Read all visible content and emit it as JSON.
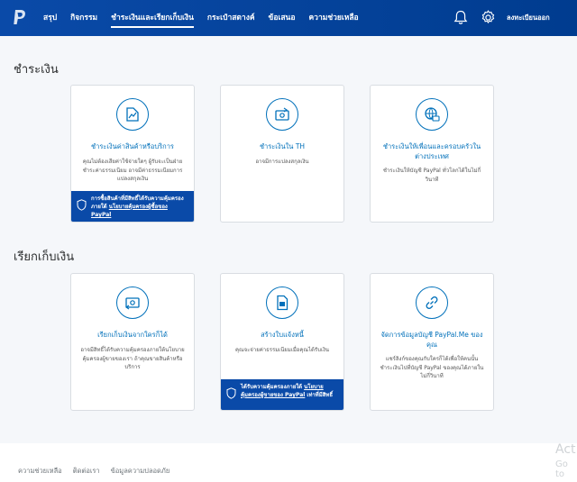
{
  "header": {
    "nav": [
      {
        "label": "สรุป"
      },
      {
        "label": "กิจกรรม"
      },
      {
        "label": "ชำระเงินและเรียกเก็บเงิน"
      },
      {
        "label": "กระเป๋าสตางค์"
      },
      {
        "label": "ข้อเสนอ"
      },
      {
        "label": "ความช่วยเหลือ"
      }
    ],
    "logout_label": "ลงทะเบียนออก",
    "brand_color": "#003c8f"
  },
  "pay": {
    "title": "ชำระเงิน",
    "cards": [
      {
        "title": "ชำระเงินค่าสินค้าหรือบริการ",
        "desc": "คุณไม่ต้องเสียค่าใช้จ่ายใดๆ ผู้รับจะเป็นฝ่ายชำระค่าธรรมเนียม อาจมีค่าธรรมเนียมการแปลงสกุลเงิน",
        "banner_text": "การซื้อสินค้าที่มีสิทธิ์ได้รับความคุ้มครองภายใต้",
        "banner_link": "นโยบายคุ้มครองผู้ซื้อของ PayPal",
        "icon": "receipt-icon"
      },
      {
        "title": "ชำระเงินใน TH",
        "desc": "อาจมีการแปลงสกุลเงิน",
        "icon": "send-money-icon"
      },
      {
        "title": "ชำระเงินให้เพื่อนและครอบครัวในต่างประเทศ",
        "desc": "ชำระเงินให้บัญชี PayPal ทั่วโลกได้ในไม่กี่วินาที",
        "icon": "globe-money-icon"
      }
    ]
  },
  "request": {
    "title": "เรียกเก็บเงิน",
    "cards": [
      {
        "title": "เรียกเก็บเงินจากใครก็ได้",
        "desc": "อาจมีสิทธิ์ได้รับความคุ้มครองภายใต้นโยบายคุ้มครองผู้ขายของเรา ถ้าคุณขายสินค้าหรือบริการ",
        "icon": "request-money-icon"
      },
      {
        "title": "สร้างใบแจ้งหนี้",
        "desc": "คุณจะจ่ายค่าธรรมเนียมเมื่อคุณได้รับเงิน",
        "banner_text": "ได้รับความคุ้มครองภายใต้",
        "banner_link": "นโยบายคุ้มครองผู้ขายของ PayPal",
        "banner_tail": "เท่าที่มีสิทธิ์",
        "icon": "invoice-icon"
      },
      {
        "title": "จัดการข้อมูลบัญชี PayPal.Me ของคุณ",
        "desc": "แชร์ลิงก์ของคุณกับใครก็ได้เพื่อให้คนนั้นชำระเงินไปที่บัญชี PayPal ของคุณได้ภายในไม่กี่วินาที",
        "icon": "link-icon"
      }
    ]
  },
  "footer": {
    "links": [
      "ความช่วยเหลือ",
      "ติดต่อเรา",
      "ข้อมูลความปลอดภัย"
    ],
    "watermark_line1": "Act",
    "watermark_line2": "Go to"
  }
}
